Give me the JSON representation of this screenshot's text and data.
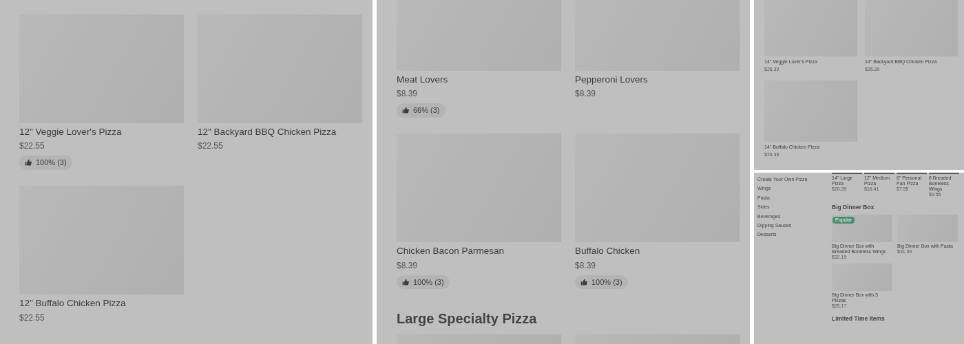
{
  "panel_1": {
    "items": [
      {
        "name": "12\" Veggie Lover's Pizza",
        "price": "$22.55",
        "rating": "100% (3)"
      },
      {
        "name": "12\" Backyard BBQ Chicken Pizza",
        "price": "$22.55"
      },
      {
        "name": "12\" Buffalo Chicken Pizza",
        "price": "$22.55"
      }
    ]
  },
  "panel_2": {
    "items": [
      {
        "name": "Meat Lovers",
        "price": "$8.39",
        "rating": "66% (3)"
      },
      {
        "name": "Pepperoni Lovers",
        "price": "$8.39"
      },
      {
        "name": "Chicken Bacon Parmesan",
        "price": "$8.39",
        "rating": "100% (3)"
      },
      {
        "name": "Buffalo Chicken",
        "price": "$8.39",
        "rating": "100% (3)"
      }
    ],
    "next_heading": "Large Specialty Pizza"
  },
  "panel_3": {
    "items": [
      {
        "name": "14\" Veggie Lover's Pizza",
        "price": "$26.39"
      },
      {
        "name": "14\" Backyard BBQ Chicken Pizza",
        "price": "$26.39"
      },
      {
        "name": "14\" Buffalo Chicken Pizza",
        "price": "$26.39"
      }
    ]
  },
  "panel_4": {
    "sidebar": [
      "Create Your Own Pizza",
      "Wings",
      "Pasta",
      "Sides",
      "Beverages",
      "Dipping Sauces",
      "Desserts"
    ],
    "top_items": [
      {
        "name": "14\" Large Pizza",
        "price": "$20.39"
      },
      {
        "name": "12\" Medium Pizza",
        "price": "$16.41"
      },
      {
        "name": "6\" Personal Pan Pizza",
        "price": "$7.55"
      },
      {
        "name": "8 Breaded Boneless Wings",
        "price": "$9.55"
      }
    ],
    "sections": [
      {
        "title": "Big Dinner Box",
        "items": [
          {
            "name": "Big Dinner Box with Breaded Boneless Wings",
            "price": "$32.19",
            "badge": "Popular"
          },
          {
            "name": "Big Dinner Box with Pasta",
            "price": "$31.39"
          },
          {
            "name": "Big Dinner Box with 3 Pizzas",
            "price": "$25.17"
          }
        ]
      },
      {
        "title": "Limited Time Items"
      }
    ]
  }
}
